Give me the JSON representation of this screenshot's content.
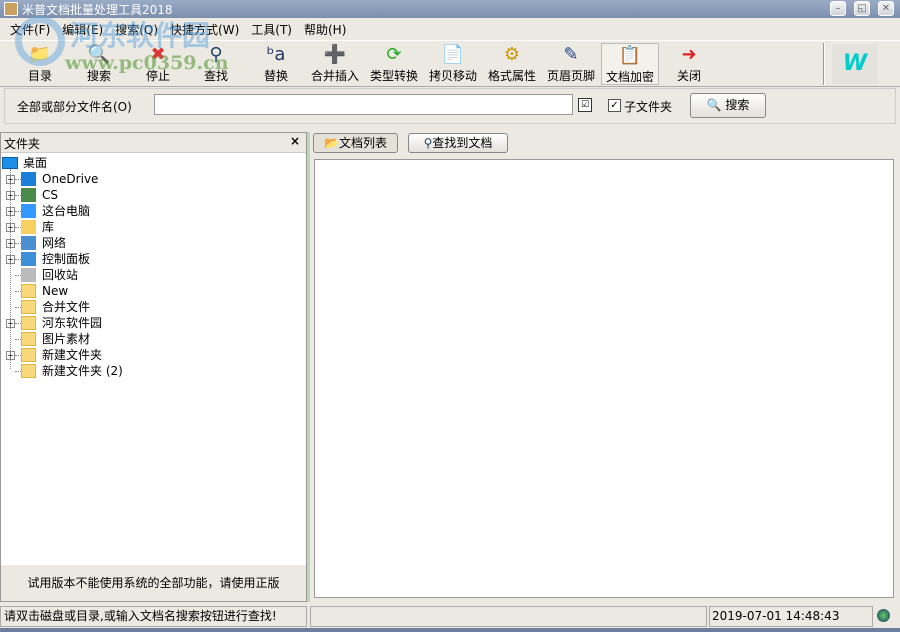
{
  "window": {
    "title": "米普文档批量处理工具2018"
  },
  "menu": [
    "文件(F)",
    "编辑(E)",
    "搜索(Q)",
    "快捷方式(W)",
    "工具(T)",
    "帮助(H)"
  ],
  "toolbar": [
    {
      "label": "目录",
      "icon": "folder-icon"
    },
    {
      "label": "搜索",
      "icon": "search-doc-icon"
    },
    {
      "label": "停止",
      "icon": "stop-icon"
    },
    {
      "label": "查找",
      "icon": "binoculars-icon"
    },
    {
      "label": "替换",
      "icon": "replace-icon"
    },
    {
      "label": "合并插入",
      "icon": "merge-icon"
    },
    {
      "label": "类型转换",
      "icon": "convert-icon"
    },
    {
      "label": "拷贝移动",
      "icon": "copy-icon"
    },
    {
      "label": "格式属性",
      "icon": "format-icon"
    },
    {
      "label": "页眉页脚",
      "icon": "header-footer-icon"
    },
    {
      "label": "文档加密",
      "icon": "encrypt-icon"
    },
    {
      "label": "关闭",
      "icon": "exit-icon"
    }
  ],
  "search": {
    "label": "全部或部分文件名(O)",
    "value": "",
    "subfolder_label": "子文件夹",
    "subfolder_checked": true,
    "button": "搜索"
  },
  "folder_panel": {
    "title": "文件夹",
    "close": "×",
    "root": "桌面",
    "items": [
      {
        "label": "OneDrive",
        "expandable": true,
        "icon": "cloud-icon"
      },
      {
        "label": "CS",
        "expandable": true,
        "icon": "user-icon"
      },
      {
        "label": "这台电脑",
        "expandable": true,
        "icon": "computer-icon"
      },
      {
        "label": "库",
        "expandable": true,
        "icon": "library-icon"
      },
      {
        "label": "网络",
        "expandable": true,
        "icon": "network-icon"
      },
      {
        "label": "控制面板",
        "expandable": true,
        "icon": "control-panel-icon"
      },
      {
        "label": "回收站",
        "expandable": false,
        "icon": "recycle-bin-icon"
      },
      {
        "label": "New",
        "expandable": false,
        "icon": "folder-icon"
      },
      {
        "label": "合并文件",
        "expandable": false,
        "icon": "folder-icon"
      },
      {
        "label": "河东软件园",
        "expandable": true,
        "icon": "folder-icon"
      },
      {
        "label": "图片素材",
        "expandable": false,
        "icon": "folder-icon"
      },
      {
        "label": "新建文件夹",
        "expandable": true,
        "icon": "folder-icon"
      },
      {
        "label": "新建文件夹 (2)",
        "expandable": false,
        "icon": "folder-icon"
      }
    ],
    "notice": "试用版本不能使用系统的全部功能，请使用正版"
  },
  "tabs": [
    "文档列表",
    "查找到文档"
  ],
  "status": {
    "message": "请双击磁盘或目录,或输入文档名搜索按钮进行查找!",
    "middle": "",
    "datetime": "2019-07-01 14:48:43"
  },
  "watermark": {
    "name": "河东软件园",
    "url": "www.pc0359.cn"
  }
}
